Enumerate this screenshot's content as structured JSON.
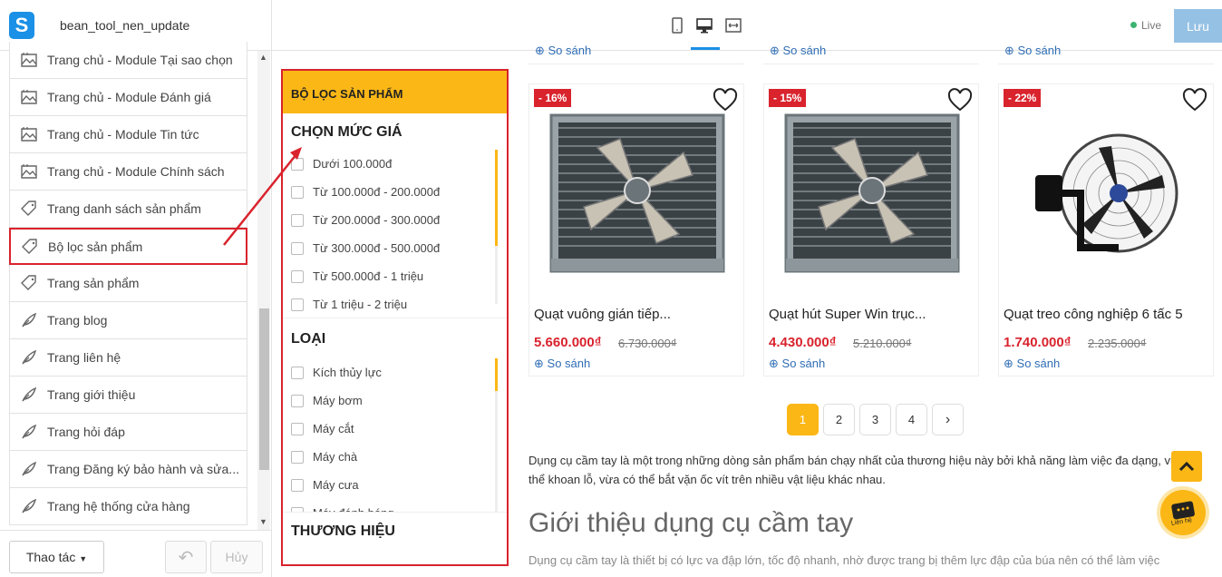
{
  "header": {
    "logo_letter": "S",
    "app_title": "bean_tool_nen_update",
    "live_label": "Live",
    "save_label": "Lưu"
  },
  "sidebar": {
    "items": [
      {
        "label": "Trang chủ - Module Tại sao chọn",
        "icon": "image-icon"
      },
      {
        "label": "Trang chủ - Module Đánh giá",
        "icon": "image-icon"
      },
      {
        "label": "Trang chủ - Module Tin tức",
        "icon": "image-icon"
      },
      {
        "label": "Trang chủ - Module Chính sách",
        "icon": "image-icon"
      },
      {
        "label": "Trang danh sách sản phẩm",
        "icon": "tag-icon"
      },
      {
        "label": "Bộ lọc sản phẩm",
        "icon": "tag-icon"
      },
      {
        "label": "Trang sản phẩm",
        "icon": "tag-icon"
      },
      {
        "label": "Trang blog",
        "icon": "feather-icon"
      },
      {
        "label": "Trang liên hệ",
        "icon": "feather-icon"
      },
      {
        "label": "Trang giới thiệu",
        "icon": "feather-icon"
      },
      {
        "label": "Trang hỏi đáp",
        "icon": "feather-icon"
      },
      {
        "label": "Trang Đăng ký bảo hành và sửa...",
        "icon": "feather-icon"
      },
      {
        "label": "Trang hệ thống cửa hàng",
        "icon": "feather-icon"
      }
    ],
    "actions_label": "Thao tác",
    "cancel_label": "Hủy"
  },
  "filter": {
    "title": "BỘ LỌC SẢN PHẨM",
    "price_title": "CHỌN MỨC GIÁ",
    "price_options": [
      "Dưới 100.000đ",
      "Từ 100.000đ - 200.000đ",
      "Từ 200.000đ - 300.000đ",
      "Từ 300.000đ - 500.000đ",
      "Từ 500.000đ - 1 triệu",
      "Từ 1 triệu - 2 triệu"
    ],
    "type_title": "LOẠI",
    "type_options": [
      "Kích thủy lực",
      "Máy bơm",
      "Máy cắt",
      "Máy chà",
      "Máy cưa",
      "Máy đánh bóng"
    ],
    "brand_title": "THƯƠNG HIỆU"
  },
  "products": [
    {
      "discount": "- 16%",
      "name": "Quạt vuông gián tiếp...",
      "price": "5.660.000₫",
      "old_price": "6.730.000₫",
      "compare": "So sánh"
    },
    {
      "discount": "- 15%",
      "name": "Quạt hút Super Win trục...",
      "price": "4.430.000₫",
      "old_price": "5.210.000₫",
      "compare": "So sánh"
    },
    {
      "discount": "- 22%",
      "name": "Quạt treo công nghiệp 6 tấc 5",
      "price": "1.740.000₫",
      "old_price": "2.235.000₫",
      "compare": "So sánh"
    }
  ],
  "top_compare": "So sánh",
  "pagination": [
    "1",
    "2",
    "3",
    "4"
  ],
  "description": "Dụng cụ cầm tay là một trong những dòng sản phẩm bán chạy nhất của thương hiệu này bởi khả năng làm việc đa dạng, vừa có thể khoan lỗ, vừa có thể bắt vặn ốc vít trên nhiều vật liệu khác nhau.",
  "intro_heading": "Giới thiệu dụng cụ cầm tay",
  "intro_text": "Dụng cụ cầm tay là thiết bị có lực va đập lớn, tốc độ nhanh, nhờ được trang bị thêm lực đập của búa nên có thể làm việc",
  "chat_label": "Liên hệ",
  "colors": {
    "accent": "#fbb716",
    "brand": "#1a90e6",
    "sale": "#d9232d",
    "link": "#2f6db5"
  }
}
